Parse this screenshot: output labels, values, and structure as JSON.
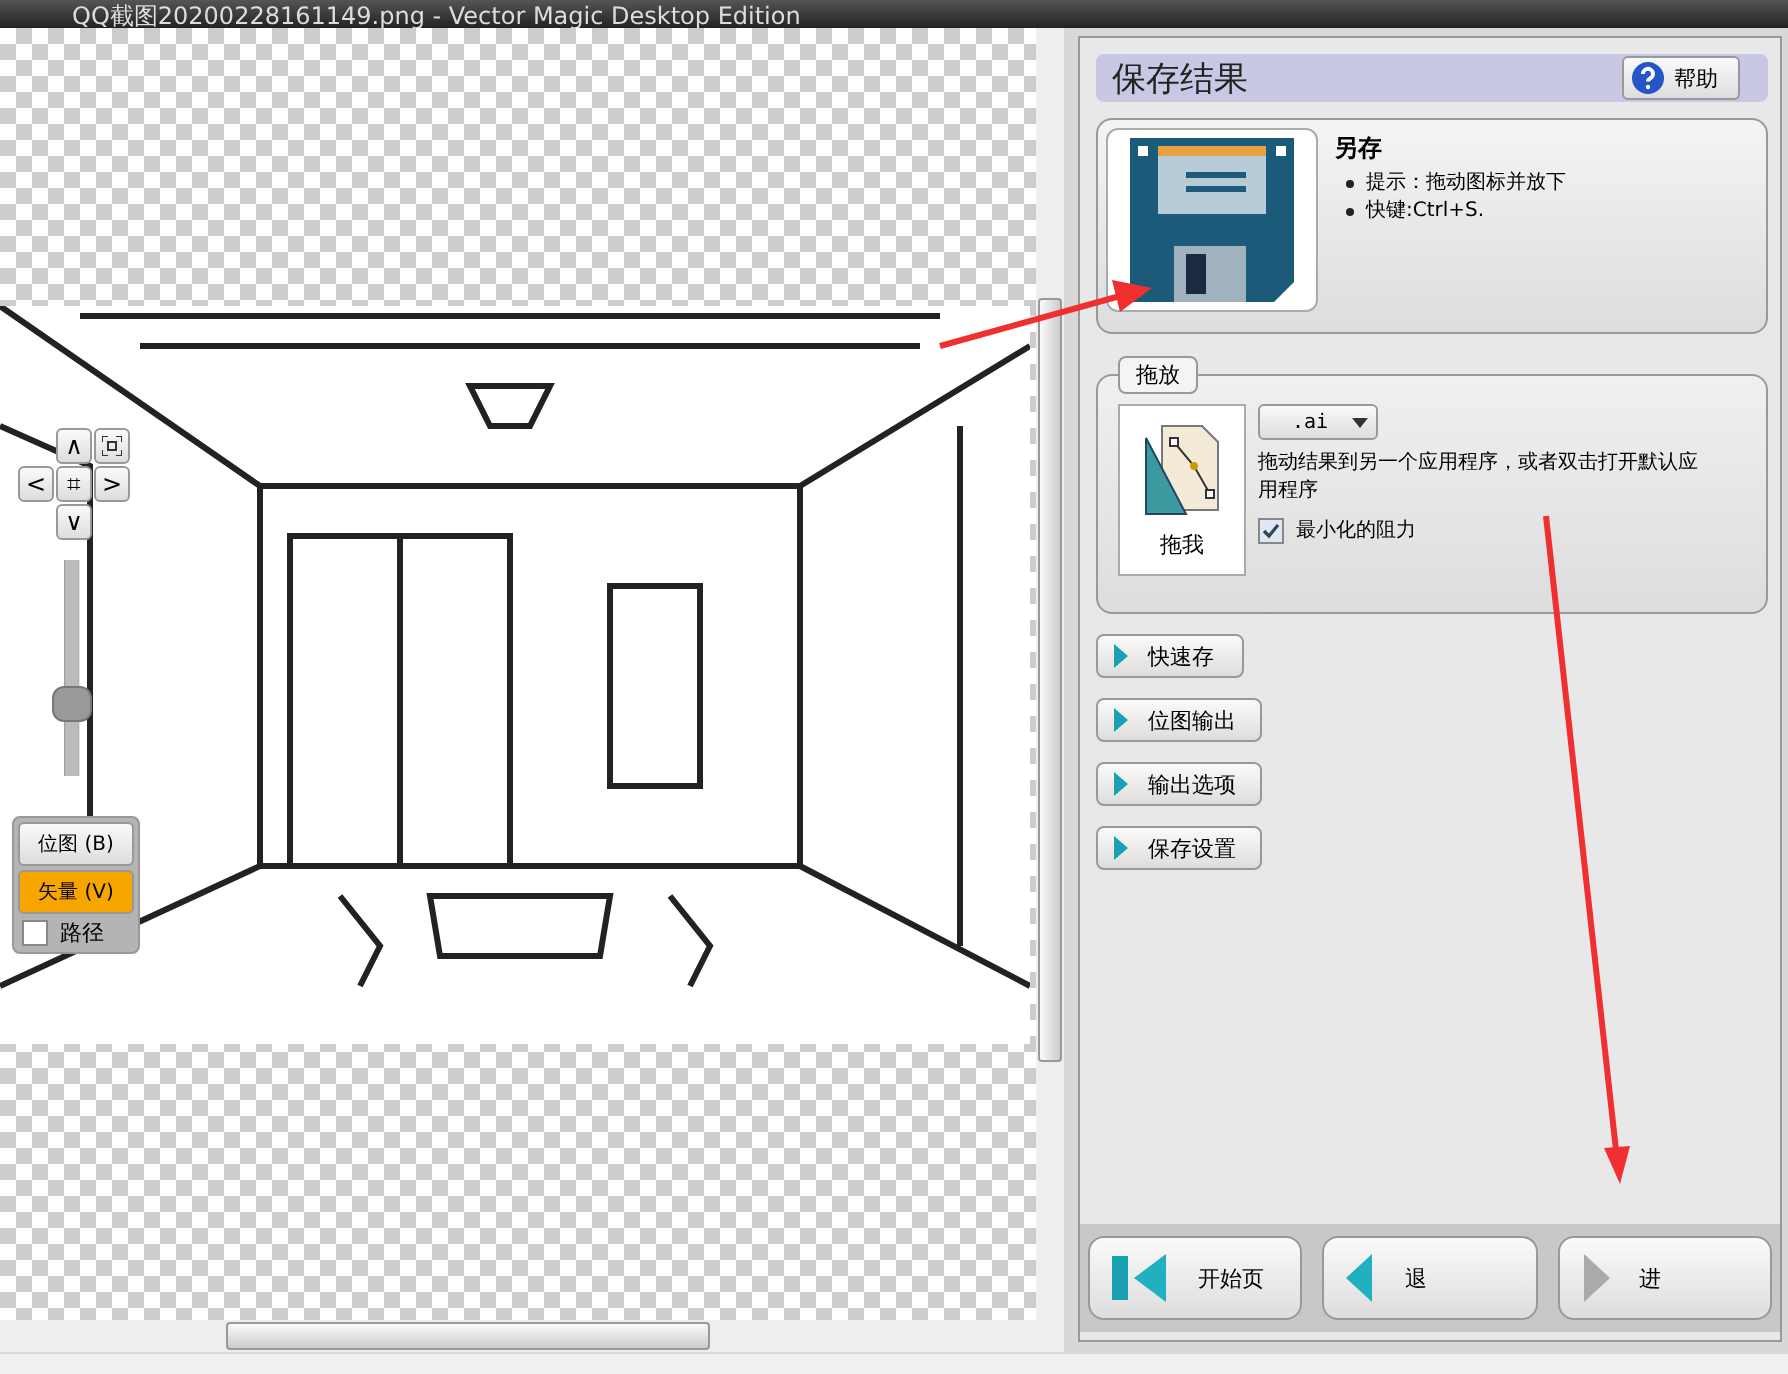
{
  "window": {
    "title": "QQ截图20200228161149.png - Vector Magic Desktop Edition"
  },
  "canvas": {
    "nav_buttons": [
      "∧",
      "<",
      "⌗",
      ">",
      "∨"
    ],
    "zoom": {
      "level": 0.3
    },
    "view_modes": [
      {
        "label": "位图 (B)",
        "selected": false
      },
      {
        "label": "矢量 (V)",
        "selected": true
      }
    ],
    "path_option": {
      "label": "路径",
      "checked": false
    }
  },
  "panel": {
    "title": "保存结果",
    "help_button": "帮助",
    "save_card": {
      "title": "另存",
      "hints": [
        "提示：拖动图标并放下",
        "快键:Ctrl+S."
      ]
    },
    "drag_group": {
      "legend": "拖放",
      "drag_label": "拖我",
      "format": ".ai",
      "description": "拖动结果到另一个应用程序，或者双击打开默认应用程序",
      "option": {
        "label": "最小化的阻力",
        "checked": true
      }
    },
    "sections": [
      "快速存",
      "位图输出",
      "输出选项",
      "保存设置"
    ],
    "nav_buttons": [
      {
        "label": "开始页",
        "kind": "start"
      },
      {
        "label": "退",
        "kind": "back"
      },
      {
        "label": "进",
        "kind": "next"
      }
    ]
  }
}
